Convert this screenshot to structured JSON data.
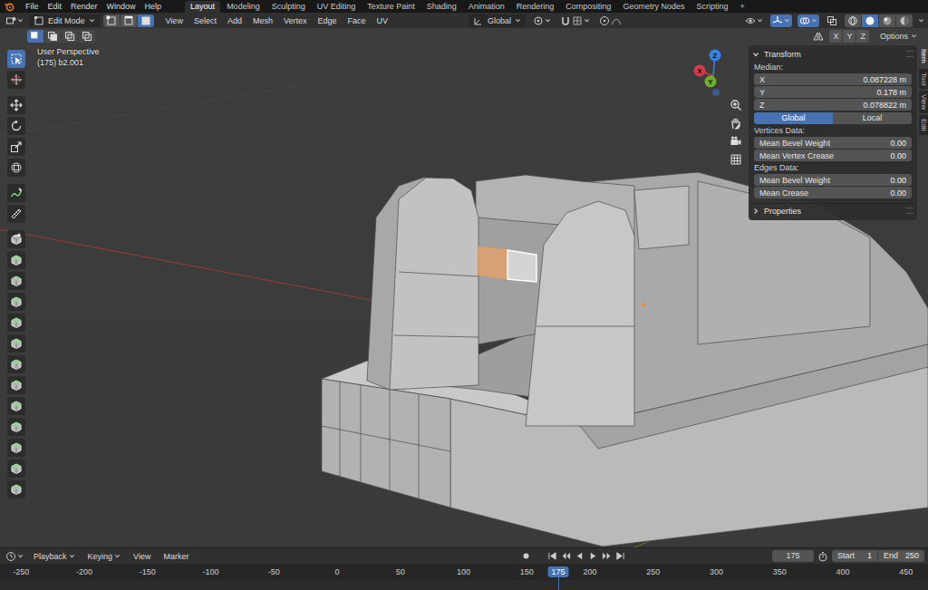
{
  "topbar": {
    "menus": [
      "File",
      "Edit",
      "Render",
      "Window",
      "Help"
    ],
    "workspaces": [
      {
        "label": "Layout",
        "selected": true
      },
      {
        "label": "Modeling",
        "selected": false
      },
      {
        "label": "Sculpting",
        "selected": false
      },
      {
        "label": "UV Editing",
        "selected": false
      },
      {
        "label": "Texture Paint",
        "selected": false
      },
      {
        "label": "Shading",
        "selected": false
      },
      {
        "label": "Animation",
        "selected": false
      },
      {
        "label": "Rendering",
        "selected": false
      },
      {
        "label": "Compositing",
        "selected": false
      },
      {
        "label": "Geometry Nodes",
        "selected": false
      },
      {
        "label": "Scripting",
        "selected": false
      }
    ],
    "add_workspace": "+"
  },
  "header": {
    "mode": "Edit Mode",
    "select_modes": [
      {
        "kind": "vertex",
        "selected": false
      },
      {
        "kind": "edge",
        "selected": false
      },
      {
        "kind": "face",
        "selected": true
      }
    ],
    "menus": [
      "View",
      "Select",
      "Add",
      "Mesh",
      "Vertex",
      "Edge",
      "Face",
      "UV"
    ],
    "orientation": "Global",
    "shading": [
      {
        "kind": "wireframe",
        "selected": false
      },
      {
        "kind": "solid",
        "selected": true
      },
      {
        "kind": "material",
        "selected": false
      },
      {
        "kind": "rendered",
        "selected": false
      }
    ]
  },
  "tool_settings": {
    "box_modes": [
      {
        "kind": "set",
        "selected": true
      },
      {
        "kind": "extend",
        "selected": false
      },
      {
        "kind": "subtract",
        "selected": false
      },
      {
        "kind": "invert",
        "selected": false
      }
    ],
    "mirror": [
      {
        "label": "X",
        "selected": false
      },
      {
        "label": "Y",
        "selected": false
      },
      {
        "label": "Z",
        "selected": false
      }
    ],
    "options": "Options"
  },
  "toolbar": {
    "tools": [
      {
        "kind": "select-box",
        "selected": true
      },
      {
        "kind": "cursor",
        "selected": false
      },
      {
        "kind": "move",
        "selected": false
      },
      {
        "kind": "rotate",
        "selected": false
      },
      {
        "kind": "scale",
        "selected": false
      },
      {
        "kind": "transform",
        "selected": false
      },
      {
        "kind": "annotate",
        "selected": false
      },
      {
        "kind": "measure",
        "selected": false
      },
      {
        "kind": "add-cube",
        "selected": false
      },
      {
        "kind": "extrude",
        "selected": false
      },
      {
        "kind": "inset",
        "selected": false
      },
      {
        "kind": "bevel",
        "selected": false
      },
      {
        "kind": "loop-cut",
        "selected": false
      },
      {
        "kind": "knife",
        "selected": false
      },
      {
        "kind": "poly-build",
        "selected": false
      },
      {
        "kind": "spin",
        "selected": false
      },
      {
        "kind": "smooth",
        "selected": false
      },
      {
        "kind": "edge-slide",
        "selected": false
      },
      {
        "kind": "shrink-fatten",
        "selected": false
      },
      {
        "kind": "shear",
        "selected": false
      },
      {
        "kind": "rip",
        "selected": false
      }
    ]
  },
  "viewport": {
    "view_name": "User Perspective",
    "object_info": "(175) b2.001",
    "gizmo_axes": [
      {
        "label": "X",
        "color": "#d6394e"
      },
      {
        "label": "Y",
        "color": "#6fae2c"
      },
      {
        "label": "Z",
        "color": "#3583e4"
      }
    ],
    "selected_faces": [
      {
        "active": false
      },
      {
        "active": true
      }
    ]
  },
  "sidebar": {
    "panel": {
      "title": "Transform",
      "expanded": true,
      "median_label": "Median:",
      "fields": [
        {
          "label": "X",
          "value": "0.087228 m"
        },
        {
          "label": "Y",
          "value": "0.178 m"
        },
        {
          "label": "Z",
          "value": "0.078822 m"
        }
      ],
      "space": [
        {
          "label": "Global",
          "selected": true
        },
        {
          "label": "Local",
          "selected": false
        }
      ],
      "sections": [
        {
          "title": "Vertices Data:",
          "fields": [
            {
              "label": "Mean Bevel Weight",
              "value": "0.00"
            },
            {
              "label": "Mean Vertex Crease",
              "value": "0.00"
            }
          ]
        },
        {
          "title": "Edges Data:",
          "fields": [
            {
              "label": "Mean Bevel Weight",
              "value": "0.00"
            },
            {
              "label": "Mean Crease",
              "value": "0.00"
            }
          ]
        }
      ]
    },
    "properties": {
      "title": "Properties",
      "expanded": false
    },
    "tabs": [
      {
        "label": "Item",
        "selected": true
      },
      {
        "label": "Tool",
        "selected": false
      },
      {
        "label": "View",
        "selected": false
      },
      {
        "label": "Edit",
        "selected": false
      }
    ]
  },
  "timeline": {
    "menus": [
      {
        "label": "Playback",
        "dropdown": true
      },
      {
        "label": "Keying",
        "dropdown": true
      },
      {
        "label": "View",
        "dropdown": false
      },
      {
        "label": "Marker",
        "dropdown": false
      }
    ],
    "current_frame": "175",
    "start": {
      "label": "Start",
      "value": "1"
    },
    "end": {
      "label": "End",
      "value": "250"
    },
    "ruler": [
      {
        "label": "-250",
        "selected": false
      },
      {
        "label": "-200",
        "selected": false
      },
      {
        "label": "-150",
        "selected": false
      },
      {
        "label": "-100",
        "selected": false
      },
      {
        "label": "-50",
        "selected": false
      },
      {
        "label": "0",
        "selected": false
      },
      {
        "label": "50",
        "selected": false
      },
      {
        "label": "100",
        "selected": false
      },
      {
        "label": "150",
        "selected": false
      },
      {
        "label": "175",
        "selected": true
      },
      {
        "label": "200",
        "selected": false
      },
      {
        "label": "250",
        "selected": false
      },
      {
        "label": "300",
        "selected": false
      },
      {
        "label": "350",
        "selected": false
      },
      {
        "label": "400",
        "selected": false
      },
      {
        "label": "450",
        "selected": false
      }
    ]
  }
}
